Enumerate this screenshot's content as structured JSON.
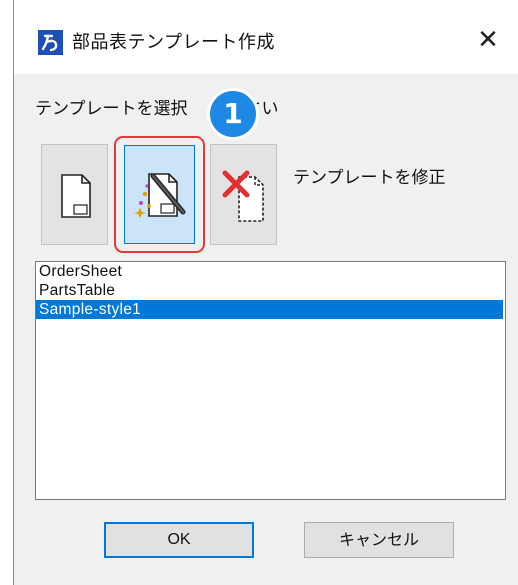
{
  "window": {
    "title": "部品表テンプレート作成",
    "icon_glyph": "&",
    "close_glyph": "✕"
  },
  "prompt": {
    "text_before": "テンプレートを選択",
    "text_after": "ださい"
  },
  "callout": {
    "number": "1",
    "color": "#1e88e5"
  },
  "toolbar": {
    "buttons": [
      {
        "name": "new-template",
        "icon": "blank-document-icon",
        "selected": false
      },
      {
        "name": "edit-template",
        "icon": "edit-document-icon",
        "selected": true
      },
      {
        "name": "delete-template",
        "icon": "delete-document-icon",
        "selected": false
      }
    ],
    "mode_label": "テンプレートを修正"
  },
  "templates": {
    "items": [
      "OrderSheet",
      "PartsTable",
      "Sample-style1"
    ],
    "selected_index": 2
  },
  "buttons": {
    "ok_label": "OK",
    "cancel_label": "キャンセル"
  },
  "colors": {
    "accent": "#0078d7",
    "highlight_border": "#e53935",
    "app_icon": "#1e4fb5"
  }
}
